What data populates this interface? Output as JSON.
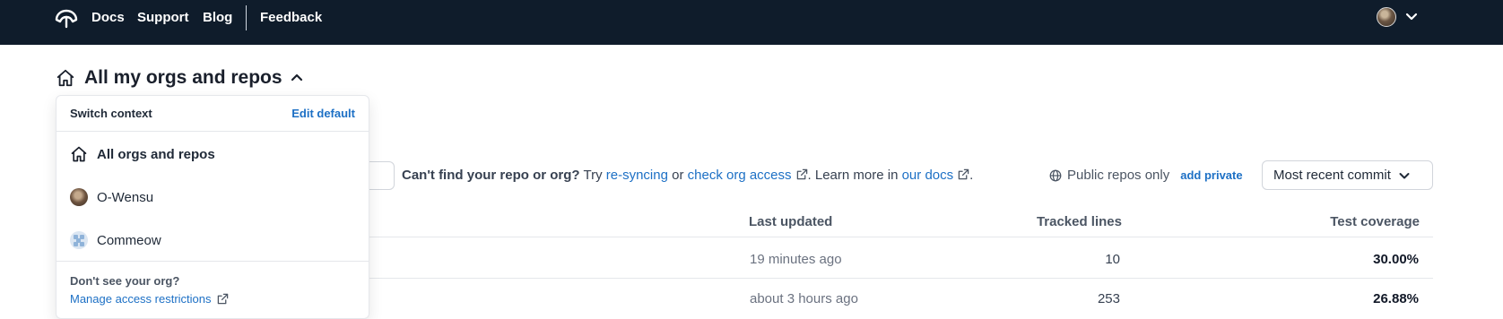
{
  "nav": {
    "links": [
      "Docs",
      "Support",
      "Blog",
      "Feedback"
    ]
  },
  "context": {
    "title": "All my orgs and repos"
  },
  "toolbar": {
    "help_bold": "Can't find your repo or org?",
    "help_try": "Try",
    "help_resync": "re-syncing",
    "help_or": "or",
    "help_check": "check org access",
    "help_learn": ". Learn more in",
    "help_docs": "our docs",
    "help_end": ".",
    "public_label": "Public repos only",
    "add_private": "add private",
    "sort_value": "Most recent commit"
  },
  "table": {
    "headers": [
      "Last updated",
      "Tracked lines",
      "Test coverage"
    ],
    "rows": [
      {
        "updated": "19 minutes ago",
        "lines": "10",
        "coverage": "30.00%"
      },
      {
        "updated": "about 3 hours ago",
        "lines": "253",
        "coverage": "26.88%"
      }
    ]
  },
  "dropdown": {
    "header": "Switch context",
    "edit_default": "Edit default",
    "items": [
      "All orgs and repos",
      "O-Wensu",
      "Commeow"
    ],
    "footer_question": "Don't see your org?",
    "footer_link": "Manage access restrictions"
  },
  "colors": {
    "topbar": "#0f1c2b",
    "link": "#1d70c5"
  }
}
